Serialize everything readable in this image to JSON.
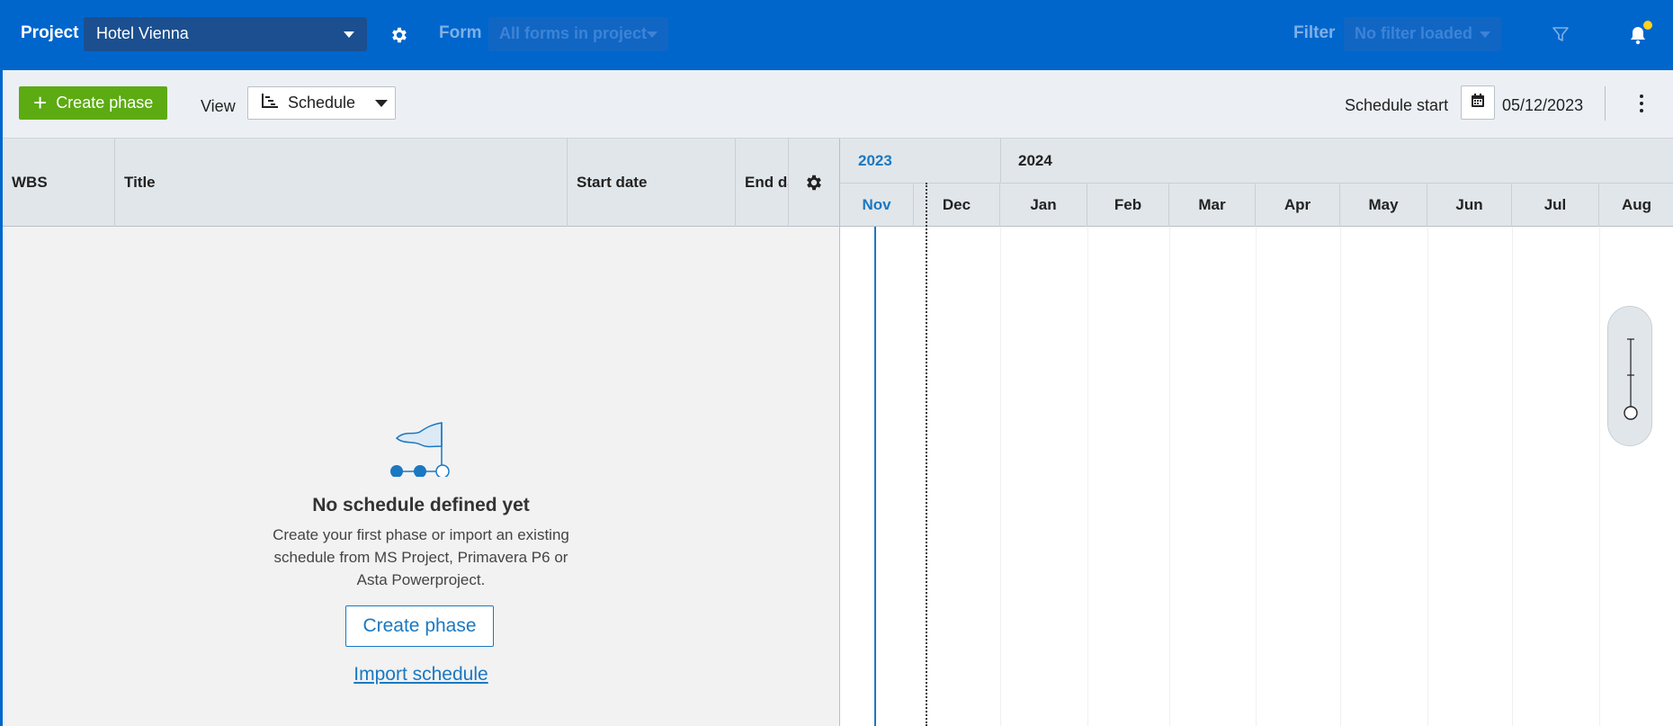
{
  "header": {
    "project_label": "Project",
    "project_value": "Hotel Vienna",
    "form_label": "Form",
    "form_value": "All forms in project",
    "filter_label": "Filter",
    "filter_value": "No filter loaded",
    "icons": [
      "gear-icon",
      "filter-icon",
      "bell-icon"
    ],
    "accent_color": "#0066cc",
    "notification_dot_color": "#ffd21f"
  },
  "toolbar": {
    "create_phase_label": "Create phase",
    "view_label": "View",
    "view_value": "Schedule",
    "schedule_start_label": "Schedule start",
    "schedule_start_value": "05/12/2023",
    "create_button_color": "#5cab12"
  },
  "table": {
    "columns": [
      "WBS",
      "Title",
      "Start date",
      "End da"
    ]
  },
  "empty_state": {
    "title": "No schedule defined yet",
    "description": "Create your first phase or import an existing schedule from MS Project, Primavera P6 or Asta Powerproject.",
    "create_button": "Create phase",
    "import_link": "Import schedule"
  },
  "gantt": {
    "years": [
      "2023",
      "2024"
    ],
    "months": [
      "Nov",
      "Dec",
      "Jan",
      "Feb",
      "Mar",
      "Apr",
      "May",
      "Jun",
      "Jul",
      "Aug"
    ],
    "current_color": "#1a78c2"
  }
}
